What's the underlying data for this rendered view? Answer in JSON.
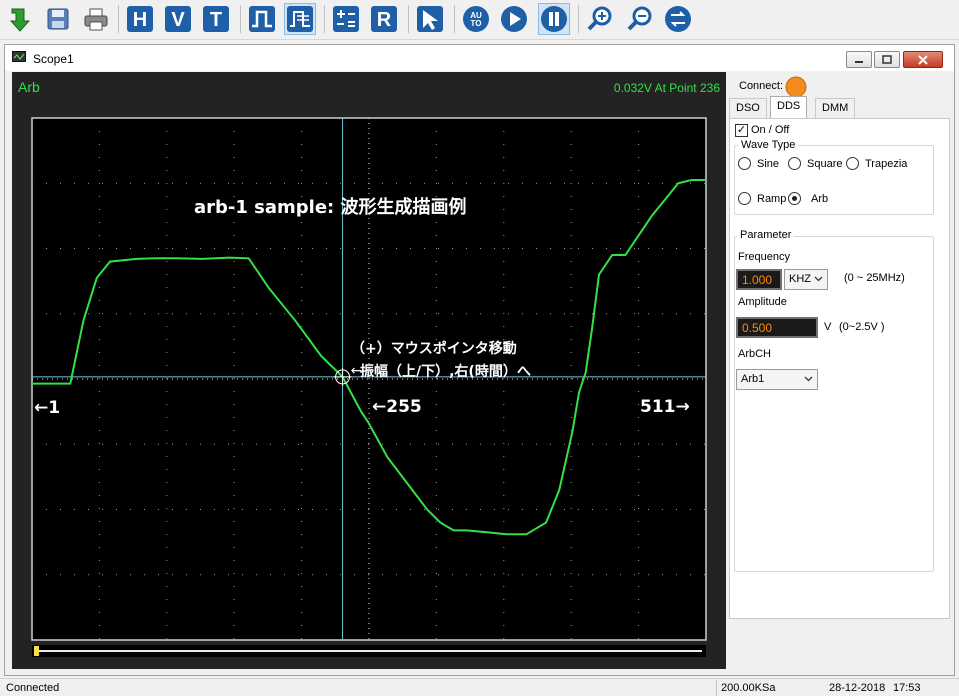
{
  "toolbar": {
    "buttons": [
      "import-icon",
      "save-icon",
      "print-icon",
      "h-cursor",
      "v-cursor",
      "t-cursor",
      "pulse-icon",
      "waveform-edit-icon",
      "math-icon",
      "r-icon",
      "pointer-icon",
      "auto-button",
      "run-icon",
      "pause-icon",
      "zoom-in-icon",
      "zoom-out-icon",
      "swap-icon"
    ],
    "letters": {
      "h": "H",
      "v": "V",
      "t": "T",
      "r": "R",
      "auto": "AU\nTO"
    }
  },
  "window": {
    "title": "Scope1"
  },
  "scope": {
    "channel_label": "Arb",
    "readout": "0.032V At Point 236",
    "annotation_title": "arb-1 sample: 波形生成描画例",
    "annotation_line1": "（+）マウスポインタ移動",
    "annotation_line2": "振幅（上/下）,右(時間）へ",
    "marker_left": "←1",
    "marker_mid": "←255",
    "marker_right": "511→",
    "colors": {
      "trace": "#33e046",
      "cursor": "#6fc9e0",
      "background": "#000000",
      "panel": "#232323",
      "grid": "#9a9a9a",
      "marker": "#f5e04a"
    }
  },
  "chart_data": {
    "type": "line",
    "x": [
      1,
      10,
      20,
      30,
      40,
      50,
      60,
      70,
      80,
      95,
      110,
      130,
      150,
      165,
      180,
      200,
      220,
      236,
      250,
      255,
      270,
      285,
      300,
      310,
      320,
      330,
      345,
      360,
      375,
      390,
      400,
      410,
      415,
      420,
      425,
      430,
      440,
      450,
      460,
      470,
      480,
      490,
      500,
      511
    ],
    "y": [
      -0.07,
      -0.07,
      -0.07,
      -0.07,
      0.9,
      1.55,
      1.8,
      1.82,
      1.84,
      1.85,
      1.85,
      1.84,
      1.86,
      1.85,
      1.4,
      0.9,
      0.35,
      0.032,
      -0.5,
      -0.65,
      -1.2,
      -1.6,
      -2.0,
      -2.2,
      -2.32,
      -2.32,
      -2.35,
      -2.38,
      -2.38,
      -2.2,
      -1.7,
      -0.8,
      -0.2,
      0.1,
      0.8,
      1.6,
      1.9,
      1.9,
      2.2,
      2.5,
      2.75,
      3.0,
      3.05,
      3.05
    ],
    "xlim": [
      1,
      511
    ],
    "title": "",
    "xlabel": "",
    "ylabel": "",
    "grid": true
  },
  "right": {
    "connect_label": "Connect:",
    "connect_color": "#f58b1f",
    "tabs": [
      {
        "label": "DSO"
      },
      {
        "label": "DDS"
      },
      {
        "label": "DMM"
      }
    ],
    "onoff_label": "On / Off",
    "onoff_checked": "✓",
    "wave_type": {
      "title": "Wave Type",
      "options": [
        {
          "label": "Sine"
        },
        {
          "label": "Square"
        },
        {
          "label": "Trapezia"
        },
        {
          "label": "Ramp"
        },
        {
          "label": "Arb"
        }
      ],
      "selected": "Arb"
    },
    "parameter": {
      "title": "Parameter",
      "frequency_label": "Frequency",
      "frequency_value": "1.000",
      "frequency_unit": "KHZ",
      "frequency_range": "(0 ~ 25MHz)",
      "amplitude_label": "Amplitude",
      "amplitude_value": "0.500",
      "amplitude_unit": "V",
      "amplitude_range": "(0~2.5V )",
      "arbch_label": "ArbCH",
      "arbch_value": "Arb1"
    }
  },
  "status": {
    "left": "Connected",
    "rate": "200.00KSa",
    "date": "28-12-2018",
    "time": "17:53"
  }
}
